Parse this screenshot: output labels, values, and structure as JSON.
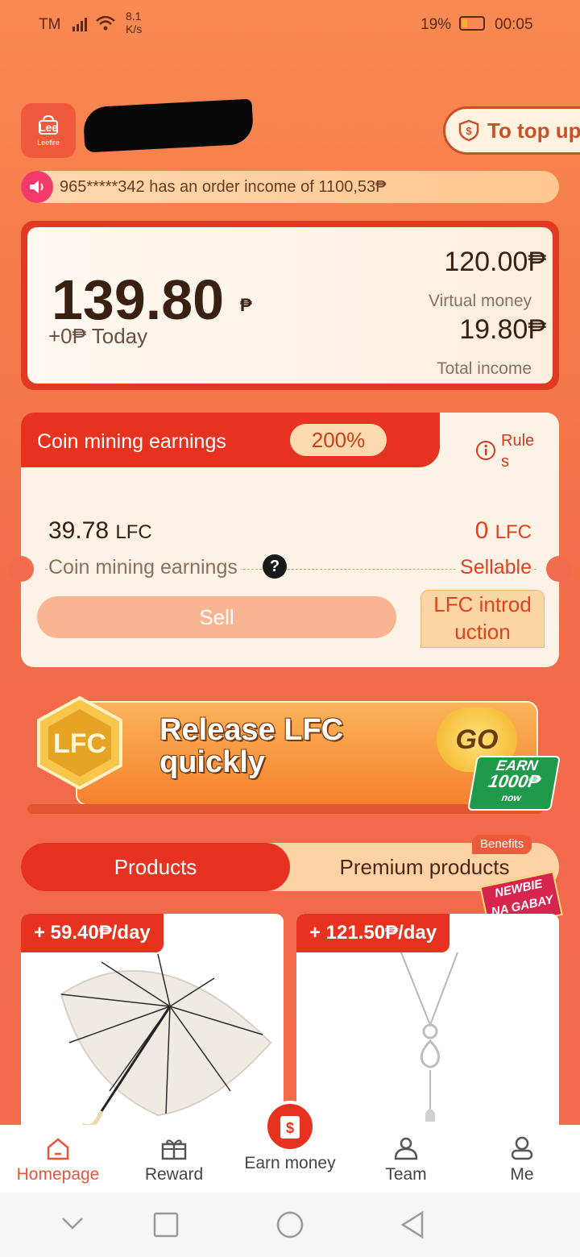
{
  "status_bar": {
    "carrier": "TM",
    "net_speed": "8.1",
    "net_unit": "K/s",
    "battery": "19%",
    "time": "00:05"
  },
  "header": {
    "logo_text": "Lee",
    "logo_sub": "Leefire",
    "topup_label": "To top up"
  },
  "ticker": {
    "text": "965*****342 has an order income of 1100,53₱"
  },
  "balance": {
    "amount": "139.80",
    "currency": "₱",
    "today": "+0₱ Today",
    "virtual_amount": "120.00₱",
    "virtual_label": "Virtual money",
    "total_amount": "19.80₱",
    "total_label": "Total income"
  },
  "mining": {
    "title": "Coin mining earnings",
    "rate": "200%",
    "rules_label": "Rule s",
    "earnings_value": "39.78",
    "earnings_unit": "LFC",
    "earnings_label": "Coin mining earnings",
    "sellable_value": "0",
    "sellable_unit": "LFC",
    "sellable_label": "Sellable",
    "sell_button": "Sell",
    "intro_button": "LFC introd uction"
  },
  "banner": {
    "badge": "LFC",
    "title_line1": "Release LFC",
    "title_line2": "quickly",
    "go": "GO",
    "earn_line1": "EARN",
    "earn_line2": "1000₱",
    "earn_line3": "now"
  },
  "tabs": {
    "products": "Products",
    "premium": "Premium products",
    "benefits_badge": "Benefits",
    "newbie_line1": "NEWBIE",
    "newbie_line2": "NA GABAY"
  },
  "products": [
    {
      "price": "+ 59.40₱/day"
    },
    {
      "price": "+ 121.50₱/day"
    }
  ],
  "nav": {
    "items": [
      "Homepage",
      "Reward",
      "Earn money",
      "Team",
      "Me"
    ],
    "active": "Homepage"
  },
  "colors": {
    "accent": "#e6321f",
    "active_nav": "#e8553a"
  }
}
